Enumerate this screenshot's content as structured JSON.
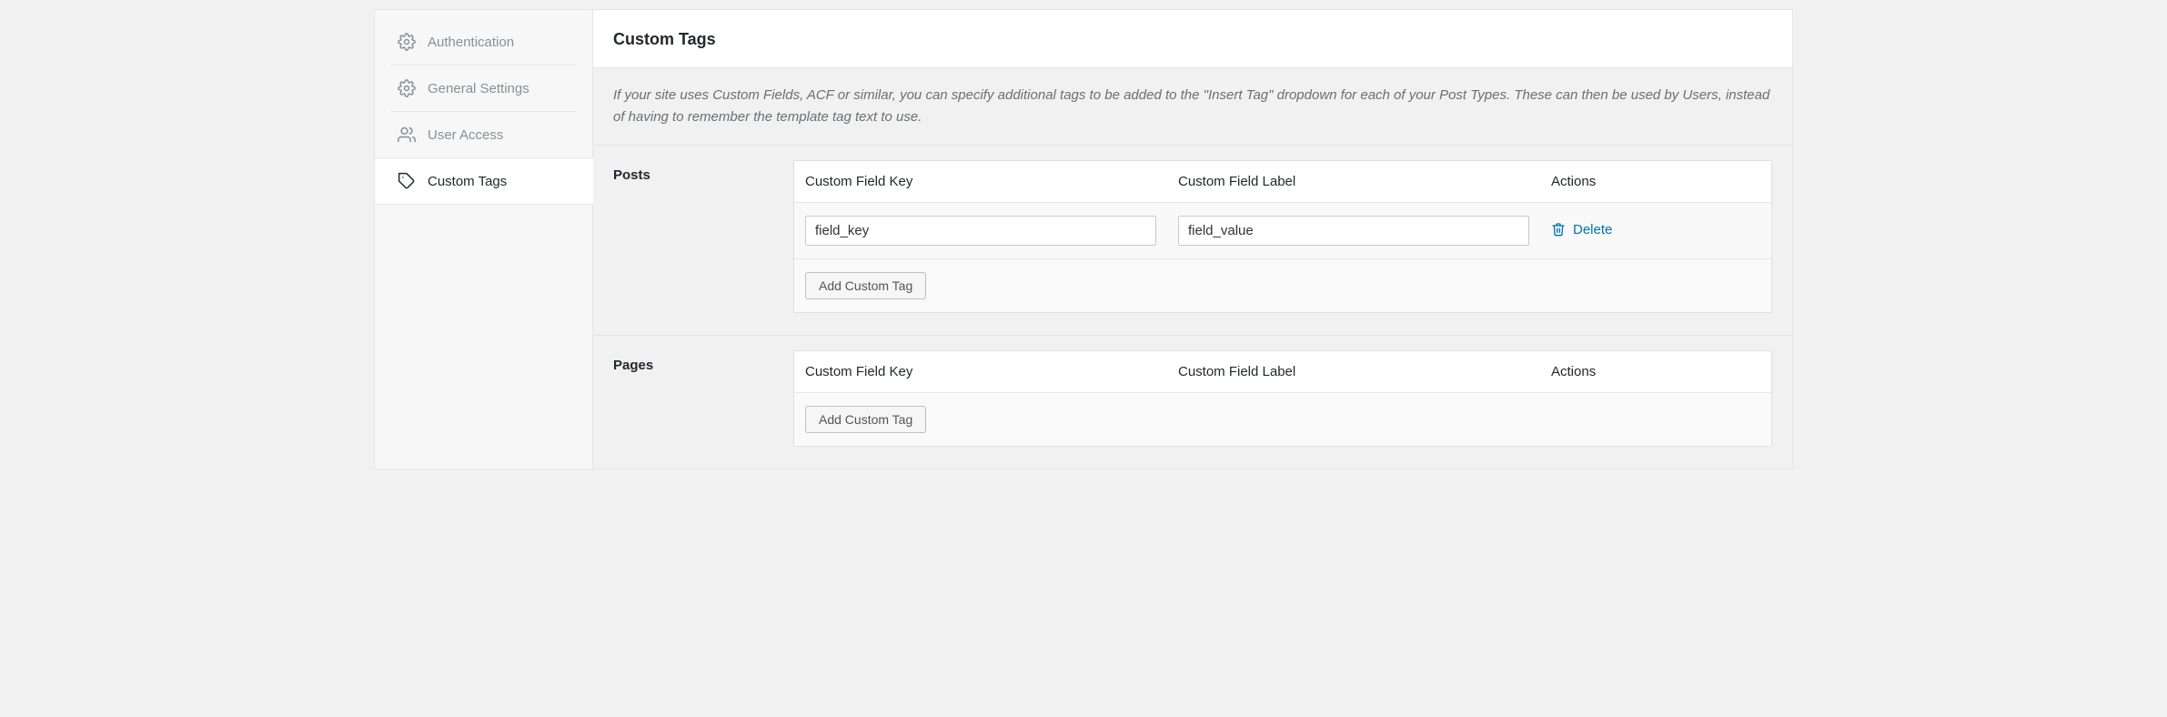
{
  "sidebar": {
    "items": [
      {
        "label": "Authentication"
      },
      {
        "label": "General Settings"
      },
      {
        "label": "User Access"
      },
      {
        "label": "Custom Tags"
      }
    ]
  },
  "header": {
    "title": "Custom Tags"
  },
  "description": "If your site uses Custom Fields, ACF or similar, you can specify additional tags to be added to the \"Insert Tag\" dropdown for each of your Post Types. These can then be used by Users, instead of having to remember the template tag text to use.",
  "columns": {
    "key": "Custom Field Key",
    "label": "Custom Field Label",
    "actions": "Actions"
  },
  "buttons": {
    "add": "Add Custom Tag",
    "delete": "Delete"
  },
  "sections": {
    "posts": {
      "title": "Posts",
      "rows": [
        {
          "key": "field_key",
          "label": "field_value"
        }
      ]
    },
    "pages": {
      "title": "Pages",
      "rows": []
    }
  }
}
